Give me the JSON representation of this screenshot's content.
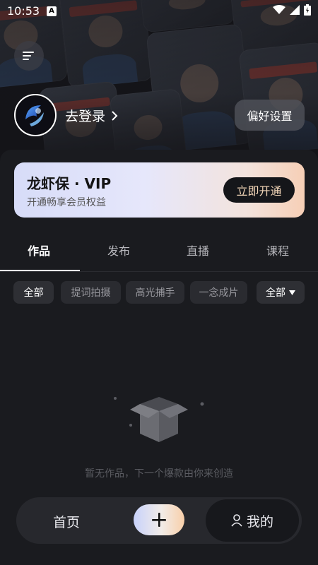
{
  "status_bar": {
    "time": "10:53",
    "notification_icon_label": "A"
  },
  "header": {
    "menu_icon": "hamburger-menu-icon",
    "login_label": "去登录",
    "preferences_label": "偏好设置"
  },
  "vip": {
    "title": "龙虾保 · VIP",
    "subtitle": "开通畅享会员权益",
    "cta_label": "立即开通"
  },
  "tabs": [
    "作品",
    "发布",
    "直播",
    "课程"
  ],
  "active_tab": "作品",
  "filters": [
    "全部",
    "提词拍摄",
    "高光捕手",
    "一念成片"
  ],
  "sort_label": "全部",
  "empty_state": {
    "message": "暂无作品，下一个爆款由你来创造"
  },
  "bottom_nav": {
    "home_label": "首页",
    "create_icon": "plus-icon",
    "mine_label": "我的"
  },
  "colors": {
    "vip_cta_text": "#f3d6b8",
    "background": "#1a1b1f",
    "accent_gradient": [
      "#c8d2fb",
      "#f8cfa9"
    ]
  }
}
